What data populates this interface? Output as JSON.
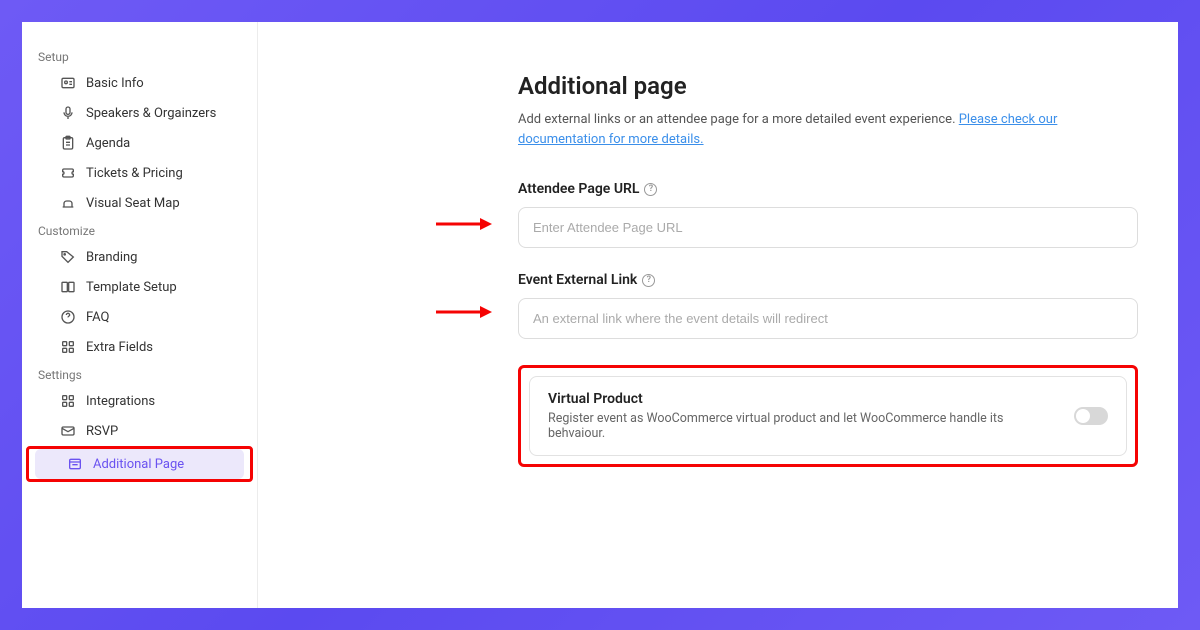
{
  "sidebar": {
    "sections": {
      "setup": "Setup",
      "customize": "Customize",
      "settings": "Settings"
    },
    "items": {
      "basicInfo": "Basic Info",
      "speakers": "Speakers & Orgainzers",
      "agenda": "Agenda",
      "tickets": "Tickets & Pricing",
      "seatMap": "Visual Seat Map",
      "branding": "Branding",
      "template": "Template Setup",
      "faq": "FAQ",
      "extra": "Extra Fields",
      "integrations": "Integrations",
      "rsvp": "RSVP",
      "additional": "Additional Page"
    }
  },
  "page": {
    "title": "Additional page",
    "desc_lead": "Add external links or an attendee page for a more detailed event experience. ",
    "doc_link": "Please check our documentation for more details.",
    "attendee_label": "Attendee Page URL",
    "attendee_placeholder": "Enter Attendee Page URL",
    "external_label": "Event External Link",
    "external_placeholder": "An external link where the event details will redirect",
    "virtual_title": "Virtual Product",
    "virtual_desc": "Register event as WooCommerce virtual product and let WooCommerce handle its behvaiour."
  }
}
